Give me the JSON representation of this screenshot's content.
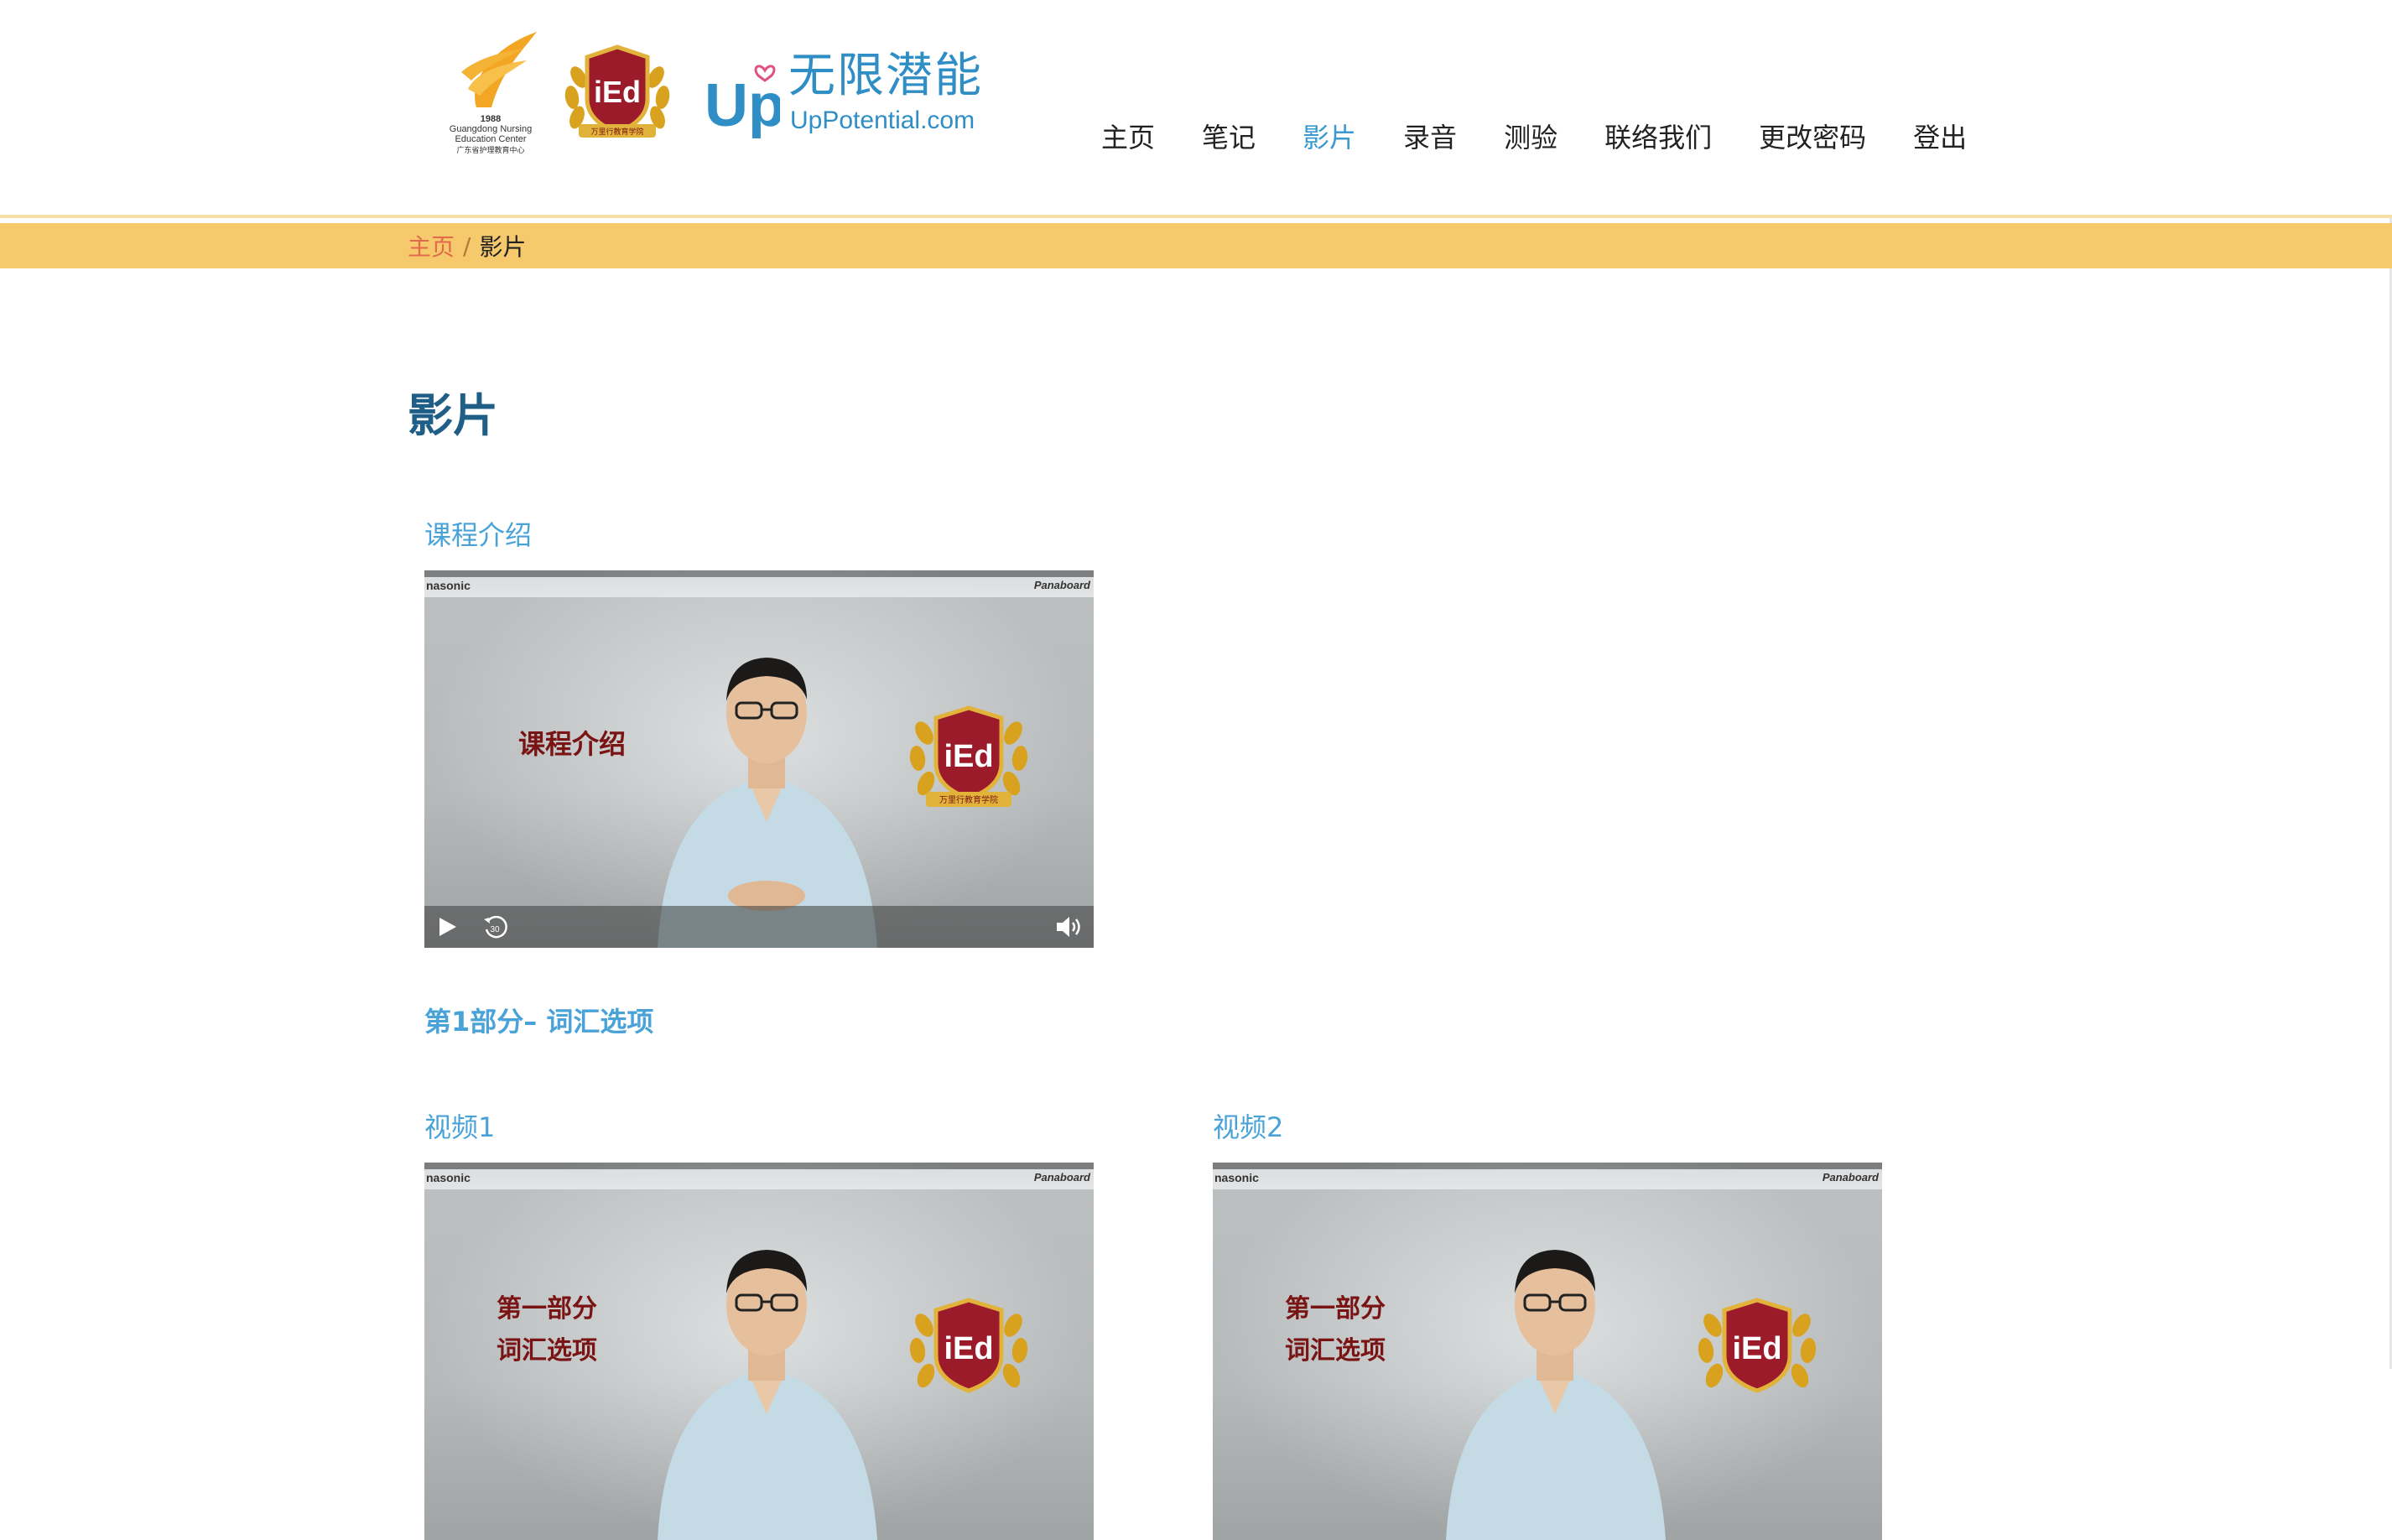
{
  "header": {
    "logos": {
      "gnec": {
        "year": "1988",
        "name_en_line1": "Guangdong Nursing",
        "name_en_line2": "Education Center",
        "name_cn": "广东省护理教育中心"
      },
      "ied": {
        "text": "iEd",
        "banner": "万里行教育学院"
      },
      "up": {
        "mark": "Up",
        "name_cn": "无限潜能",
        "name_en": "UpPotential.com"
      }
    },
    "nav": [
      {
        "label": "主页",
        "active": false
      },
      {
        "label": "笔记",
        "active": false
      },
      {
        "label": "影片",
        "active": true
      },
      {
        "label": "录音",
        "active": false
      },
      {
        "label": "测验",
        "active": false
      },
      {
        "label": "联络我们",
        "active": false
      },
      {
        "label": "更改密码",
        "active": false
      },
      {
        "label": "登出",
        "active": false
      }
    ]
  },
  "breadcrumb": {
    "home": "主页",
    "separator": "/",
    "current": "影片"
  },
  "main": {
    "title": "影片",
    "intro": {
      "label": "课程介绍",
      "overlay_text": "课程介绍"
    },
    "section1": {
      "heading": "第1部分– 词汇选项",
      "videos": [
        {
          "label": "视频1",
          "overlay_line1": "第一部分",
          "overlay_line2": "词汇选项"
        },
        {
          "label": "视频2",
          "overlay_line1": "第一部分",
          "overlay_line2": "词汇选项"
        }
      ]
    },
    "player": {
      "brand_left": "nasonic",
      "brand_right": "Panaboard",
      "seal_text": "iEd",
      "seal_banner": "万里行教育学院",
      "replay_seconds": "30"
    }
  },
  "colors": {
    "accent": "#3a99cf",
    "title": "#1f5f87",
    "link": "#4aa3d8",
    "crumb_bar": "#f6c96d",
    "crumb_link": "#e06a4a",
    "overlay_text": "#7a1414"
  }
}
